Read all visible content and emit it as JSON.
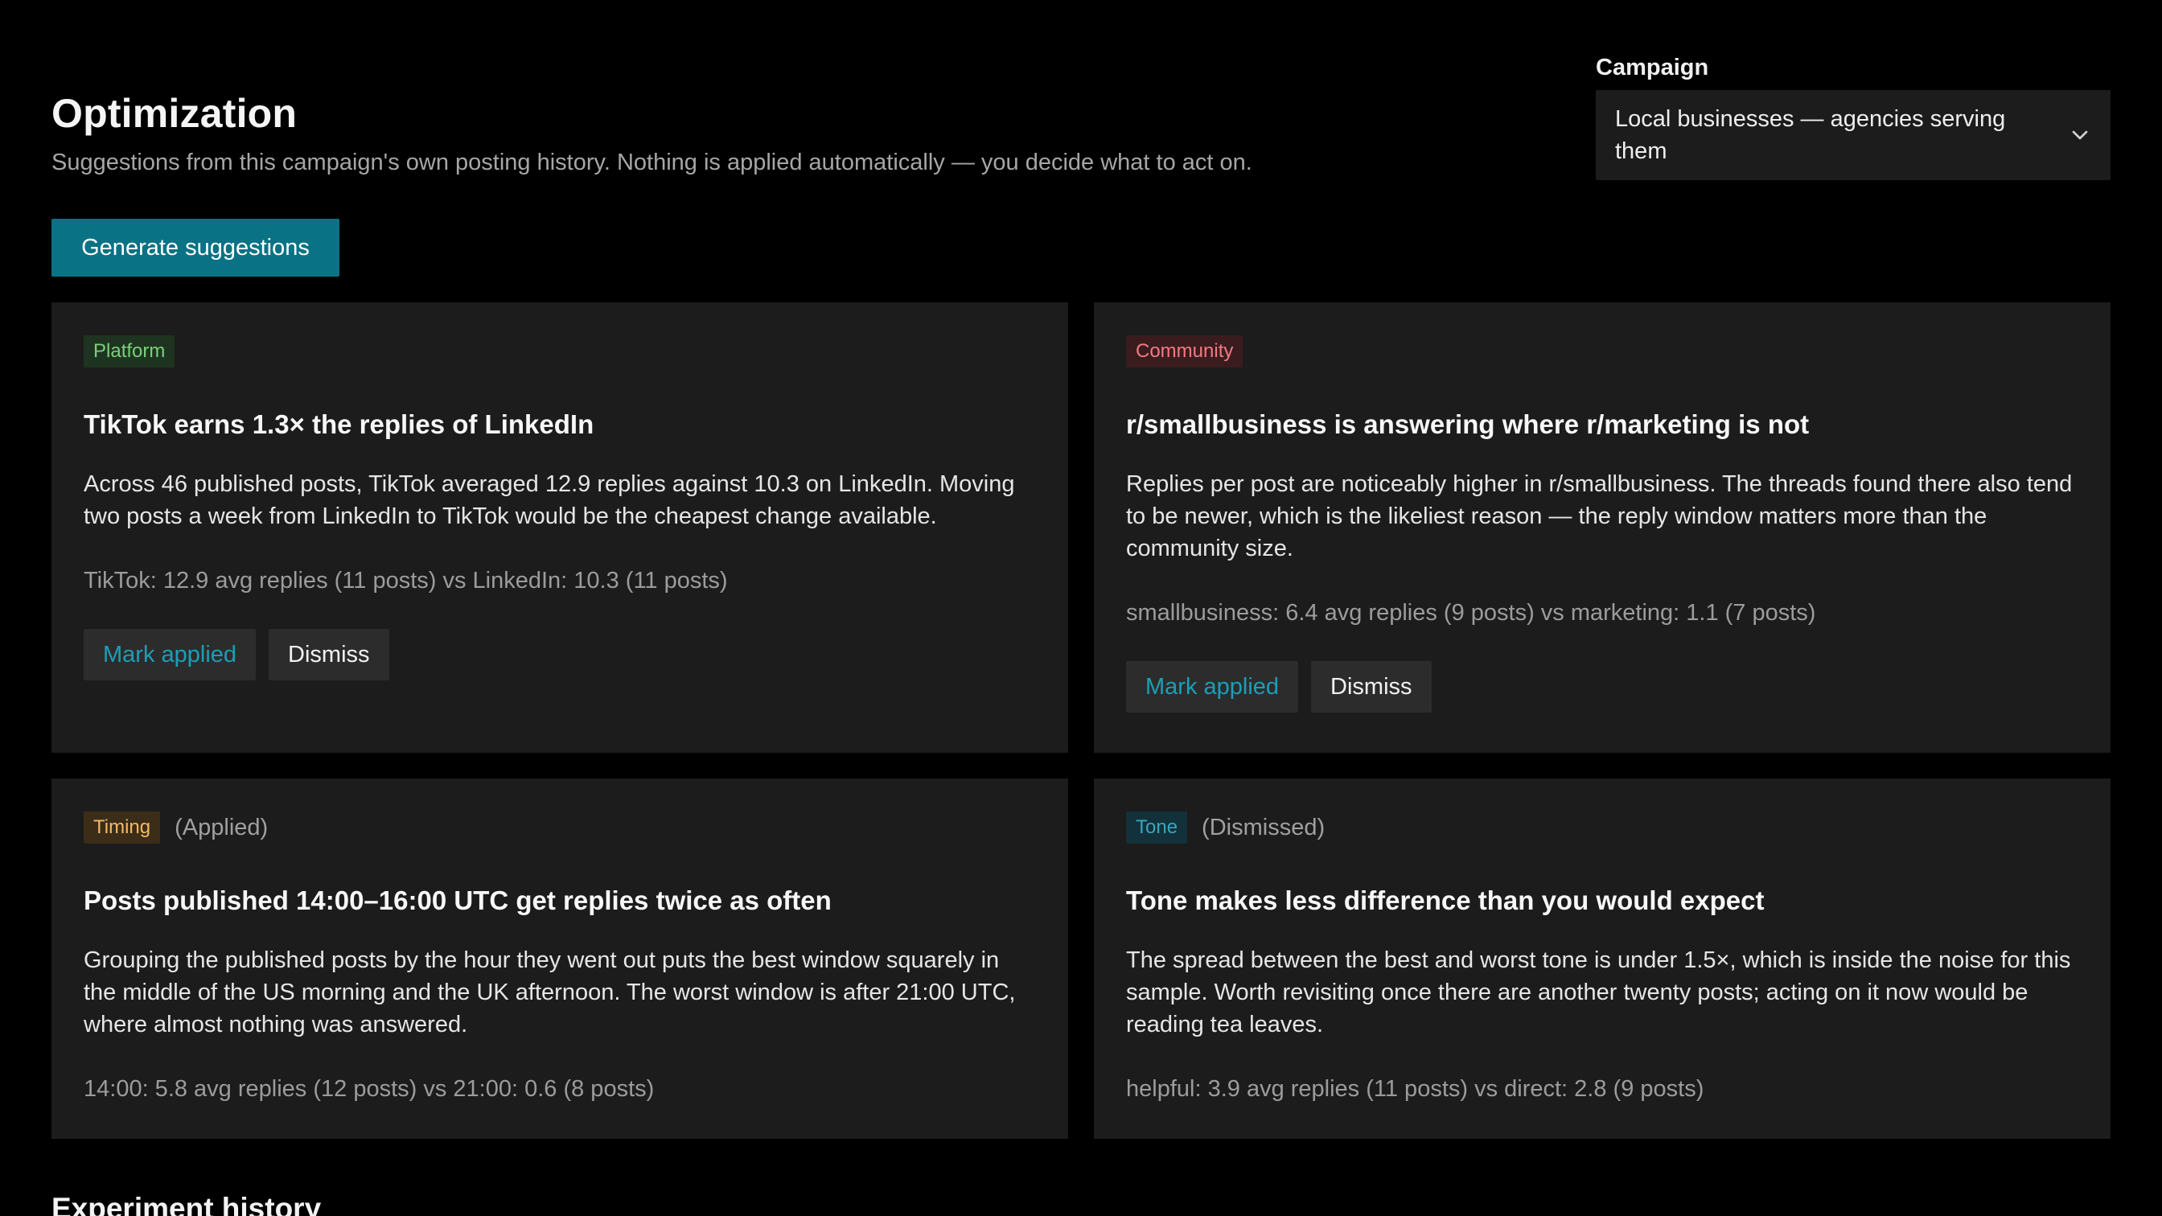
{
  "header": {
    "title": "Optimization",
    "subtitle": "Suggestions from this campaign's own posting history. Nothing is applied automatically — you decide what to act on.",
    "generate_label": "Generate suggestions"
  },
  "campaign": {
    "label": "Campaign",
    "selected": "Local businesses — agencies serving them",
    "icon": "chevron-down-icon"
  },
  "cards": [
    {
      "tag": "Platform",
      "status": "",
      "title": "TikTok earns 1.3× the replies of LinkedIn",
      "body": "Across 46 published posts, TikTok averaged 12.9 replies against 10.3 on LinkedIn. Moving two posts a week from LinkedIn to TikTok would be the cheapest change available.",
      "stat": "TikTok: 12.9 avg replies (11 posts) vs LinkedIn: 10.3 (11 posts)",
      "apply_label": "Mark applied",
      "dismiss_label": "Dismiss"
    },
    {
      "tag": "Community",
      "status": "",
      "title": "r/smallbusiness is answering where r/marketing is not",
      "body": "Replies per post are noticeably higher in r/smallbusiness. The threads found there also tend to be newer, which is the likeliest reason — the reply window matters more than the community size.",
      "stat": "smallbusiness: 6.4 avg replies (9 posts) vs marketing: 1.1 (7 posts)",
      "apply_label": "Mark applied",
      "dismiss_label": "Dismiss"
    },
    {
      "tag": "Timing",
      "status": "(Applied)",
      "title": "Posts published 14:00–16:00 UTC get replies twice as often",
      "body": "Grouping the published posts by the hour they went out puts the best window squarely in the middle of the US morning and the UK afternoon. The worst window is after 21:00 UTC, where almost nothing was answered.",
      "stat": "14:00: 5.8 avg replies (12 posts) vs 21:00: 0.6 (8 posts)"
    },
    {
      "tag": "Tone",
      "status": "(Dismissed)",
      "title": "Tone makes less difference than you would expect",
      "body": "The spread between the best and worst tone is under 1.5×, which is inside the noise for this sample. Worth revisiting once there are another twenty posts; acting on it now would be reading tea leaves.",
      "stat": "helpful: 3.9 avg replies (11 posts) vs direct: 2.8 (9 posts)"
    }
  ],
  "history": {
    "title": "Experiment history"
  },
  "colors": {
    "background": "#000000",
    "card": "#1c1c1c",
    "accent": "#0a7285",
    "link": "#1a9fb8"
  }
}
